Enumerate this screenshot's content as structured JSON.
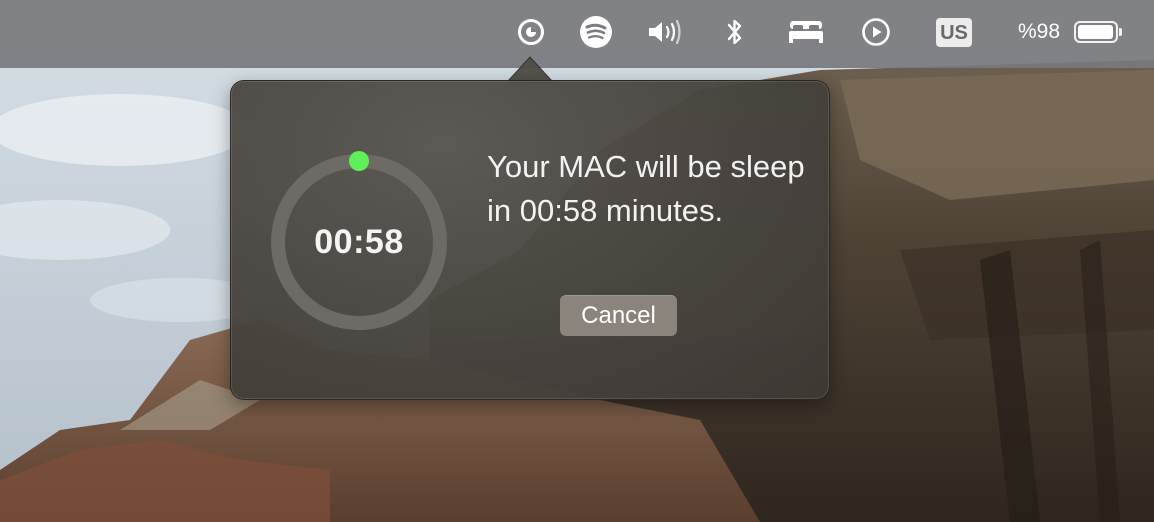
{
  "menubar": {
    "icons": {
      "timer": "timer-icon",
      "spotify": "spotify-icon",
      "volume": "volume-icon",
      "bluetooth": "bluetooth-icon",
      "sleep": "bed-icon",
      "play": "play-icon",
      "battery": "battery-icon"
    },
    "input_source": "US",
    "battery_text": "%98",
    "battery_level": 0.98
  },
  "popover": {
    "countdown": "00:58",
    "message": "Your MAC will be sleep in 00:58 minutes.",
    "cancel_label": "Cancel",
    "ring_progress": 0.0,
    "colors": {
      "indicator": "#5ef05a",
      "ring_track": "#6e6a66",
      "button": "#8a847d"
    }
  }
}
